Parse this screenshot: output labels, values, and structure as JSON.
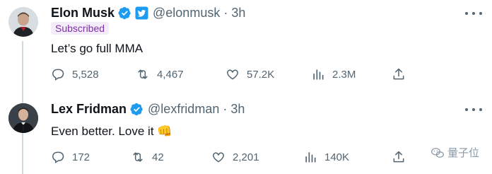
{
  "tweets": [
    {
      "author_name": "Elon Musk",
      "handle": "@elonmusk",
      "separator": "·",
      "time": "3h",
      "subscribed_label": "Subscribed",
      "text": "Let’s go full MMA",
      "counts": {
        "replies": "5,528",
        "retweets": "4,467",
        "likes": "57.2K",
        "views": "2.3M"
      }
    },
    {
      "author_name": "Lex Fridman",
      "handle": "@lexfridman",
      "separator": "·",
      "time": "3h",
      "text": "Even better. Love it 👊",
      "counts": {
        "replies": "172",
        "retweets": "42",
        "likes": "2,201",
        "views": "140K"
      }
    }
  ],
  "watermark": "量子位",
  "colors": {
    "verified": "#1d9bf0",
    "secondary_text": "#536471",
    "subscribed_bg": "#f5ecfa",
    "subscribed_text": "#7c2fa6"
  }
}
